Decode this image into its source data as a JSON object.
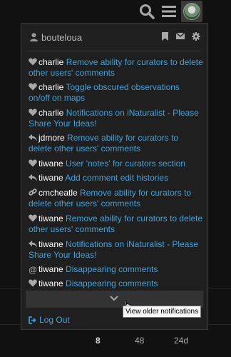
{
  "header": {
    "icons": [
      "search-icon",
      "hamburger-menu-icon",
      "user-avatar"
    ]
  },
  "panel": {
    "username": "bouteloua",
    "head_icons": [
      "bookmark-icon",
      "envelope-icon",
      "gear-icon"
    ],
    "notifications": [
      {
        "icon": "heart-icon",
        "user": "charlie",
        "text": "Remove ability for curators to delete other users' comments"
      },
      {
        "icon": "heart-icon",
        "user": "charlie",
        "text": "Toggle obscured observations on/off on maps"
      },
      {
        "icon": "heart-icon",
        "user": "charlie",
        "text": "Notifications on iNaturalist - Please Share Your Ideas!"
      },
      {
        "icon": "reply-icon",
        "user": "jdmore",
        "text": "Remove ability for curators to delete other users' comments"
      },
      {
        "icon": "heart-icon",
        "user": "tiwane",
        "text": "User 'notes' for curators section"
      },
      {
        "icon": "reply-icon",
        "user": "tiwane",
        "text": "Add comment edit histories"
      },
      {
        "icon": "link-icon",
        "user": "cmcheatle",
        "text": "Remove ability for curators to delete other users' comments"
      },
      {
        "icon": "heart-icon",
        "user": "tiwane",
        "text": "Remove ability for curators to delete other users' comments"
      },
      {
        "icon": "reply-icon",
        "user": "tiwane",
        "text": "Notifications on iNaturalist - Please Share Your Ideas!"
      },
      {
        "icon": "at-icon",
        "user": "tiwane",
        "text": "Disappearing comments"
      },
      {
        "icon": "heart-icon",
        "user": "tiwane",
        "text": "Disappearing comments"
      }
    ],
    "more_icon": "chevron-down-icon",
    "logout_label": "Log Out"
  },
  "tooltip": "View older notifications",
  "background_stats": [
    "8",
    "48",
    "24d"
  ],
  "colors": {
    "background": "#111111",
    "panel": "#1f1f1f",
    "link": "#3ea3dc",
    "username": "#ffffff"
  }
}
